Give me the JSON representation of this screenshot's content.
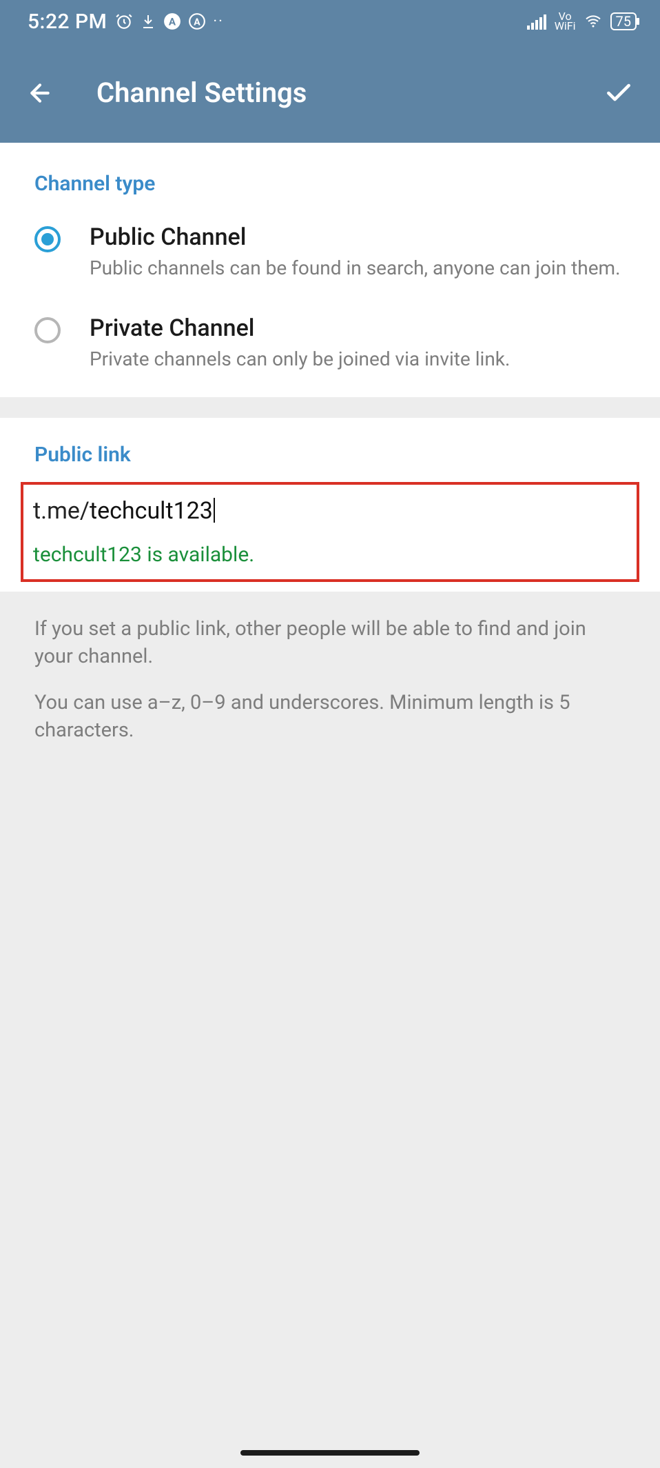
{
  "status": {
    "time": "5:22 PM",
    "network_label_top": "Vo",
    "network_label_bottom": "WiFi",
    "battery": "75"
  },
  "header": {
    "title": "Channel Settings"
  },
  "channel_type": {
    "section_title": "Channel type",
    "options": [
      {
        "label": "Public Channel",
        "desc": "Public channels can be found in search, anyone can join them.",
        "checked": true
      },
      {
        "label": "Private Channel",
        "desc": "Private channels can only be joined via invite link.",
        "checked": false
      }
    ]
  },
  "public_link": {
    "section_title": "Public link",
    "prefix": "t.me/",
    "value": "techcult123",
    "status": "techcult123 is available.",
    "hint1": "If you set a public link, other people will be able to find and join your channel.",
    "hint2": "You can use a–z, 0–9 and underscores. Minimum length is 5 characters."
  }
}
